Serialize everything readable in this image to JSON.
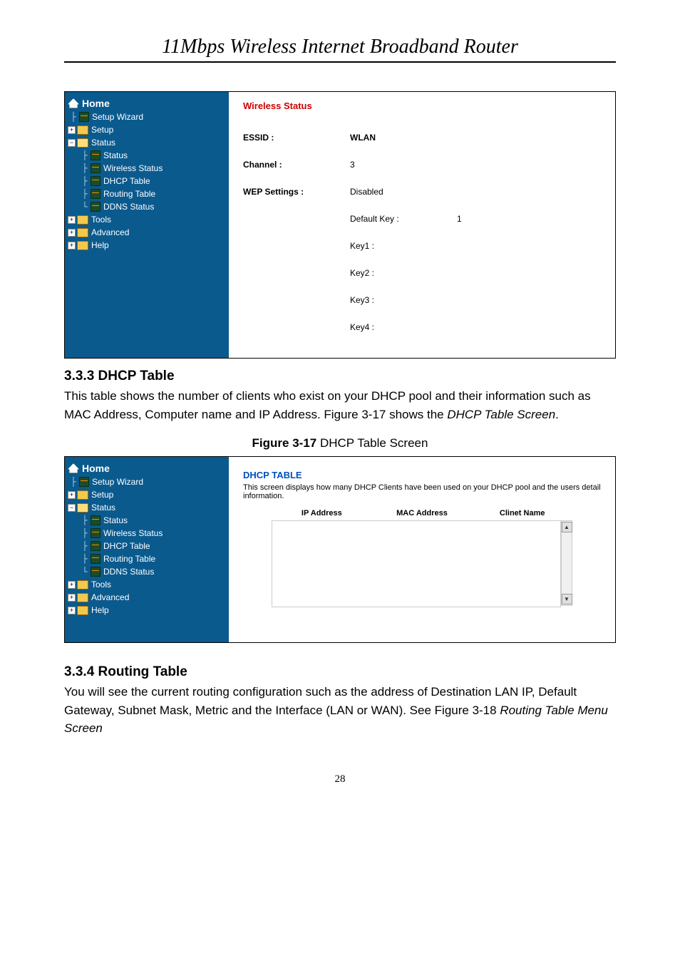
{
  "header_title": "11Mbps  Wireless  Internet  Broadband  Router",
  "nav": {
    "home": "Home",
    "setup_wizard": "Setup Wizard",
    "setup": "Setup",
    "status": "Status",
    "status_sub": "Status",
    "wireless_status": "Wireless Status",
    "dhcp_table": "DHCP Table",
    "routing_table": "Routing Table",
    "ddns_status": "DDNS Status",
    "tools": "Tools",
    "advanced": "Advanced",
    "help": "Help"
  },
  "wireless_status_panel": {
    "heading": "Wireless Status",
    "rows": [
      {
        "label": "ESSID :",
        "value": "WLAN"
      },
      {
        "label": "Channel :",
        "value": "3"
      },
      {
        "label": "WEP Settings :",
        "value": "Disabled"
      }
    ],
    "extra": {
      "default_key_label": "Default Key :",
      "default_key_value": "1",
      "key1": "Key1 :",
      "key2": "Key2 :",
      "key3": "Key3 :",
      "key4": "Key4 :"
    }
  },
  "section_333": {
    "heading": "3.3.3 DHCP Table",
    "body_pre": "This table shows the number of clients who exist on your DHCP pool and their information such as MAC Address, Computer name and IP Address. Figure 3-17 shows the ",
    "body_italic": "DHCP Table Screen",
    "body_post": "."
  },
  "figure_317": {
    "caption_bold": "Figure 3-17 ",
    "caption_rest": "DHCP Table Screen"
  },
  "dhcp_panel": {
    "heading": "DHCP TABLE",
    "desc": "This screen displays how many DHCP Clients have been used on your DHCP pool and the users detail information.",
    "col1": "IP Address",
    "col2": "MAC Address",
    "col3": "Clinet Name"
  },
  "section_334": {
    "heading": "3.3.4 Routing Table",
    "body_pre": "You will see the current routing configuration such as the address of Destination LAN IP, Default Gateway, Subnet Mask, Metric and the Interface (LAN or WAN). See Figure 3-18 ",
    "body_italic": "Routing Table Menu Screen"
  },
  "page_number": "28"
}
